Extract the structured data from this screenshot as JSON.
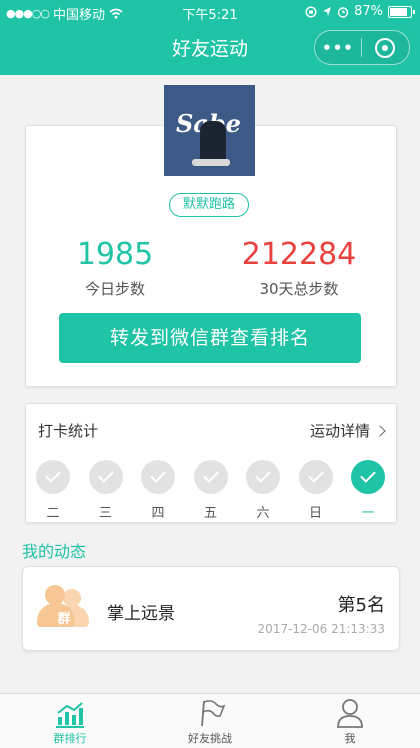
{
  "status_bar": {
    "signal_dots": "●●●○○",
    "carrier": "中国移动",
    "wifi_icon": "wifi",
    "time": "下午5:21",
    "battery_percent": "87%"
  },
  "nav": {
    "title": "好友运动",
    "more_label": "•••"
  },
  "profile": {
    "avatar_text": "Sabe",
    "name": "默默跑路",
    "today_steps": "1985",
    "today_label": "今日步数",
    "total_steps": "212284",
    "total_label": "30天总步数",
    "share_button": "转发到微信群查看排名"
  },
  "checkin": {
    "title": "打卡统计",
    "detail_link": "运动详情",
    "days": [
      {
        "label": "二",
        "checked": false
      },
      {
        "label": "三",
        "checked": false
      },
      {
        "label": "四",
        "checked": false
      },
      {
        "label": "五",
        "checked": false
      },
      {
        "label": "六",
        "checked": false
      },
      {
        "label": "日",
        "checked": false
      },
      {
        "label": "一",
        "checked": true
      }
    ]
  },
  "activity": {
    "section_title": "我的动态",
    "group_badge": "群",
    "group_name": "掌上远景",
    "rank": "第5名",
    "timestamp": "2017-12-06 21:13:33"
  },
  "tabbar": {
    "tabs": [
      {
        "label": "群排行",
        "icon": "bar-chart-icon",
        "active": true
      },
      {
        "label": "好友挑战",
        "icon": "flag-icon",
        "active": false
      },
      {
        "label": "我",
        "icon": "person-icon",
        "active": false
      }
    ]
  },
  "colors": {
    "accent": "#1fc3a5",
    "total_steps": "#e8413e",
    "group_icon": "#f6c694"
  }
}
